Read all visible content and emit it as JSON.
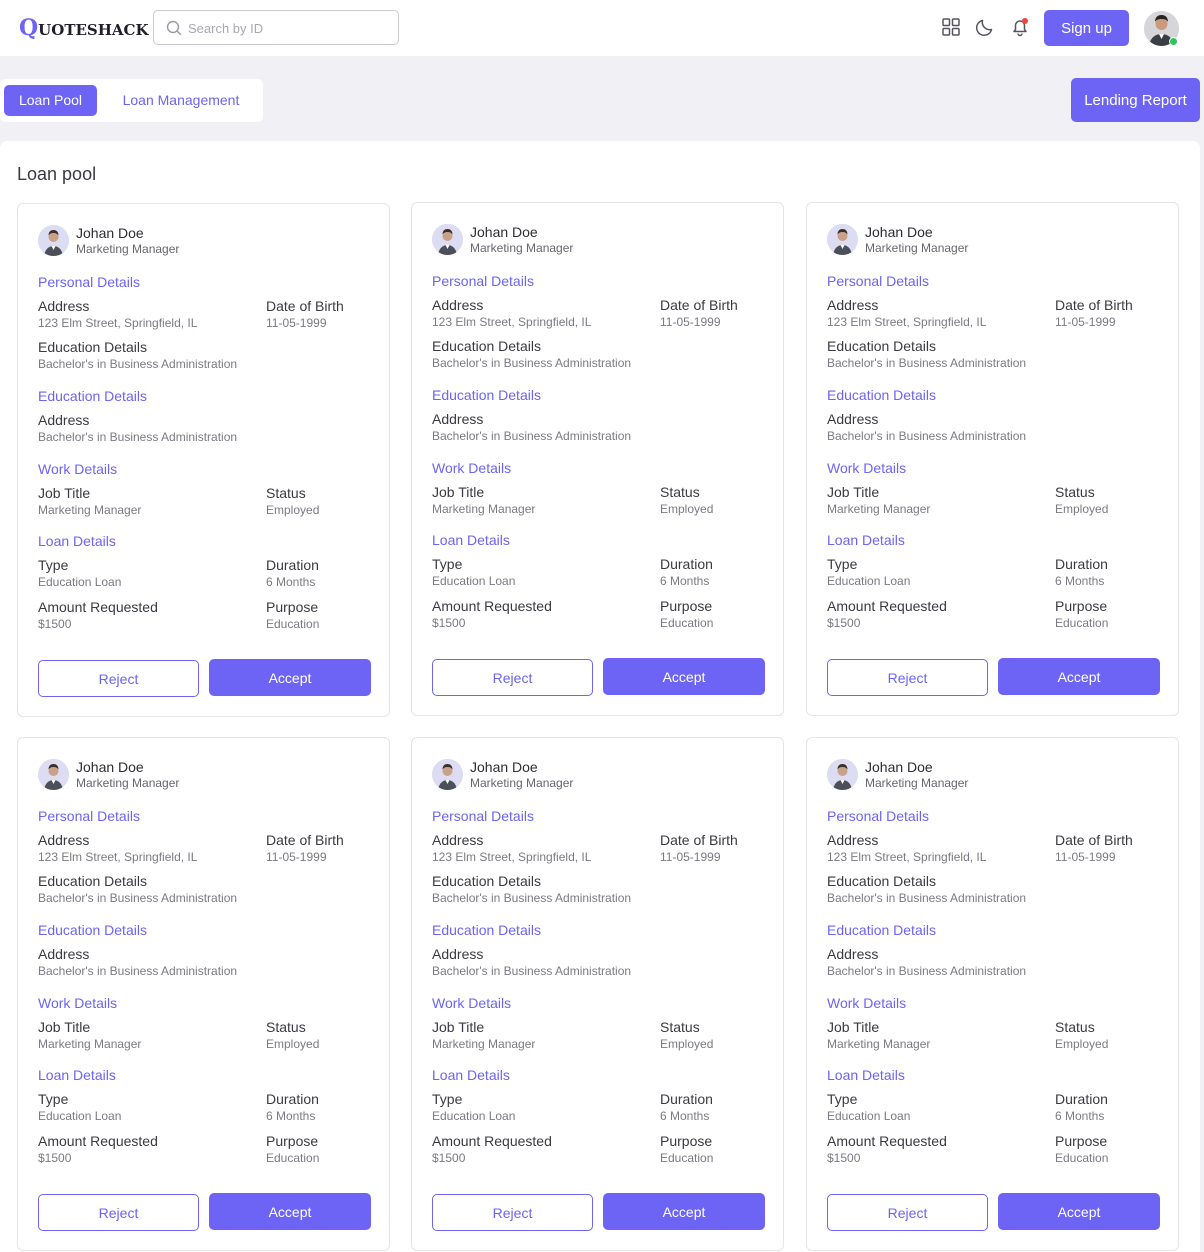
{
  "header": {
    "logo_first": "Q",
    "logo_rest": "UOTESHACK",
    "search_placeholder": "Search by ID",
    "signup_label": "Sign up"
  },
  "tabs": [
    {
      "label": "Loan Pool",
      "active": true
    },
    {
      "label": "Loan Management",
      "active": false
    }
  ],
  "lending_report_label": "Lending Report",
  "panel_title": "Loan pool",
  "cards": [
    {
      "name": "Johan Doe",
      "role": "Marketing Manager",
      "personal_heading": "Personal Details",
      "address_label": "Address",
      "address": "123 Elm Street, Springfield, IL",
      "dob_label": "Date of Birth",
      "dob": "11-05-1999",
      "edu_label": "Education Details",
      "edu": "Bachelor's in Business Administration",
      "education_heading": "Education Details",
      "edu_address_label": "Address",
      "edu_address": "Bachelor's in Business Administration",
      "work_heading": "Work Details",
      "job_label": "Job Title",
      "job": "Marketing Manager",
      "status_label": "Status",
      "status": "Employed",
      "loan_heading": "Loan Details",
      "type_label": "Type",
      "type": "Education Loan",
      "duration_label": "Duration",
      "duration": "6 Months",
      "amount_label": "Amount Requested",
      "amount": "$1500",
      "purpose_label": "Purpose",
      "purpose": "Education",
      "reject_label": "Reject",
      "accept_label": "Accept"
    },
    {
      "name": "Johan Doe",
      "role": "Marketing Manager",
      "personal_heading": "Personal Details",
      "address_label": "Address",
      "address": "123 Elm Street, Springfield, IL",
      "dob_label": "Date of Birth",
      "dob": "11-05-1999",
      "edu_label": "Education Details",
      "edu": "Bachelor's in Business Administration",
      "education_heading": "Education Details",
      "edu_address_label": "Address",
      "edu_address": "Bachelor's in Business Administration",
      "work_heading": "Work Details",
      "job_label": "Job Title",
      "job": "Marketing Manager",
      "status_label": "Status",
      "status": "Employed",
      "loan_heading": "Loan Details",
      "type_label": "Type",
      "type": "Education Loan",
      "duration_label": "Duration",
      "duration": "6 Months",
      "amount_label": "Amount Requested",
      "amount": "$1500",
      "purpose_label": "Purpose",
      "purpose": "Education",
      "reject_label": "Reject",
      "accept_label": "Accept"
    },
    {
      "name": "Johan Doe",
      "role": "Marketing Manager",
      "personal_heading": "Personal Details",
      "address_label": "Address",
      "address": "123 Elm Street, Springfield, IL",
      "dob_label": "Date of Birth",
      "dob": "11-05-1999",
      "edu_label": "Education Details",
      "edu": "Bachelor's in Business Administration",
      "education_heading": "Education Details",
      "edu_address_label": "Address",
      "edu_address": "Bachelor's in Business Administration",
      "work_heading": "Work Details",
      "job_label": "Job Title",
      "job": "Marketing Manager",
      "status_label": "Status",
      "status": "Employed",
      "loan_heading": "Loan Details",
      "type_label": "Type",
      "type": "Education Loan",
      "duration_label": "Duration",
      "duration": "6 Months",
      "amount_label": "Amount Requested",
      "amount": "$1500",
      "purpose_label": "Purpose",
      "purpose": "Education",
      "reject_label": "Reject",
      "accept_label": "Accept"
    },
    {
      "name": "Johan Doe",
      "role": "Marketing Manager",
      "personal_heading": "Personal Details",
      "address_label": "Address",
      "address": "123 Elm Street, Springfield, IL",
      "dob_label": "Date of Birth",
      "dob": "11-05-1999",
      "edu_label": "Education Details",
      "edu": "Bachelor's in Business Administration",
      "education_heading": "Education Details",
      "edu_address_label": "Address",
      "edu_address": "Bachelor's in Business Administration",
      "work_heading": "Work Details",
      "job_label": "Job Title",
      "job": "Marketing Manager",
      "status_label": "Status",
      "status": "Employed",
      "loan_heading": "Loan Details",
      "type_label": "Type",
      "type": "Education Loan",
      "duration_label": "Duration",
      "duration": "6 Months",
      "amount_label": "Amount Requested",
      "amount": "$1500",
      "purpose_label": "Purpose",
      "purpose": "Education",
      "reject_label": "Reject",
      "accept_label": "Accept"
    },
    {
      "name": "Johan Doe",
      "role": "Marketing Manager",
      "personal_heading": "Personal Details",
      "address_label": "Address",
      "address": "123 Elm Street, Springfield, IL",
      "dob_label": "Date of Birth",
      "dob": "11-05-1999",
      "edu_label": "Education Details",
      "edu": "Bachelor's in Business Administration",
      "education_heading": "Education Details",
      "edu_address_label": "Address",
      "edu_address": "Bachelor's in Business Administration",
      "work_heading": "Work Details",
      "job_label": "Job Title",
      "job": "Marketing Manager",
      "status_label": "Status",
      "status": "Employed",
      "loan_heading": "Loan Details",
      "type_label": "Type",
      "type": "Education Loan",
      "duration_label": "Duration",
      "duration": "6 Months",
      "amount_label": "Amount Requested",
      "amount": "$1500",
      "purpose_label": "Purpose",
      "purpose": "Education",
      "reject_label": "Reject",
      "accept_label": "Accept"
    },
    {
      "name": "Johan Doe",
      "role": "Marketing Manager",
      "personal_heading": "Personal Details",
      "address_label": "Address",
      "address": "123 Elm Street, Springfield, IL",
      "dob_label": "Date of Birth",
      "dob": "11-05-1999",
      "edu_label": "Education Details",
      "edu": "Bachelor's in Business Administration",
      "education_heading": "Education Details",
      "edu_address_label": "Address",
      "edu_address": "Bachelor's in Business Administration",
      "work_heading": "Work Details",
      "job_label": "Job Title",
      "job": "Marketing Manager",
      "status_label": "Status",
      "status": "Employed",
      "loan_heading": "Loan Details",
      "type_label": "Type",
      "type": "Education Loan",
      "duration_label": "Duration",
      "duration": "6 Months",
      "amount_label": "Amount Requested",
      "amount": "$1500",
      "purpose_label": "Purpose",
      "purpose": "Education",
      "reject_label": "Reject",
      "accept_label": "Accept"
    }
  ],
  "icons": {
    "search": "search-icon",
    "apps": "grid-icon",
    "theme": "moon-icon",
    "notifications": "bell-icon",
    "user": "avatar"
  },
  "colors": {
    "accent": "#6d63f4",
    "notification_dot": "#f04438",
    "online_dot": "#2fc45a",
    "page_bg": "#f0f0f5"
  }
}
